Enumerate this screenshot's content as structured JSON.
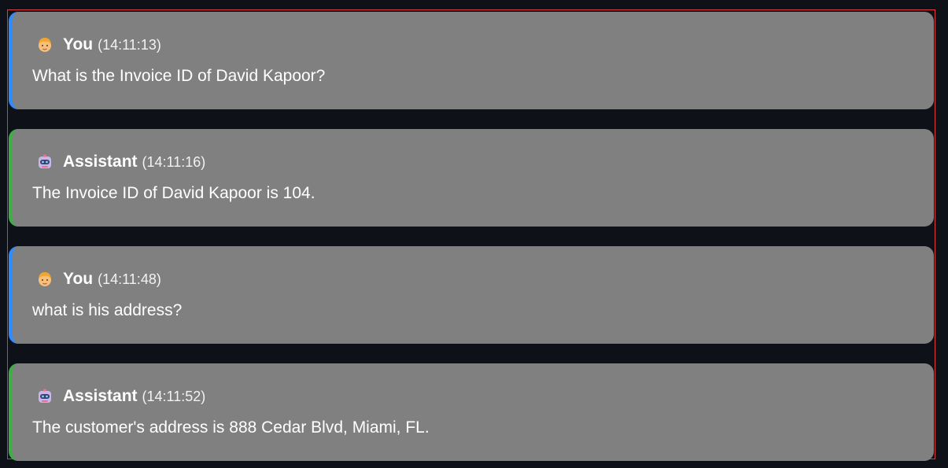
{
  "messages": [
    {
      "role": "user",
      "avatar_icon": "person-blond-icon",
      "author": "You",
      "time": "(14:11:13)",
      "text": "What is the Invoice ID of David Kapoor?"
    },
    {
      "role": "assistant",
      "avatar_icon": "robot-icon",
      "author": "Assistant",
      "time": "(14:11:16)",
      "text": "The Invoice ID of David Kapoor is 104."
    },
    {
      "role": "user",
      "avatar_icon": "person-blond-icon",
      "author": "You",
      "time": "(14:11:48)",
      "text": "what is his address?"
    },
    {
      "role": "assistant",
      "avatar_icon": "robot-icon",
      "author": "Assistant",
      "time": "(14:11:52)",
      "text": "The customer's address is 888 Cedar Blvd, Miami, FL."
    }
  ],
  "colors": {
    "background": "#0e1117",
    "bubble": "#808080",
    "user_accent": "#2f8cff",
    "assistant_accent": "#3fae49",
    "frame_border": "#e0393e"
  }
}
